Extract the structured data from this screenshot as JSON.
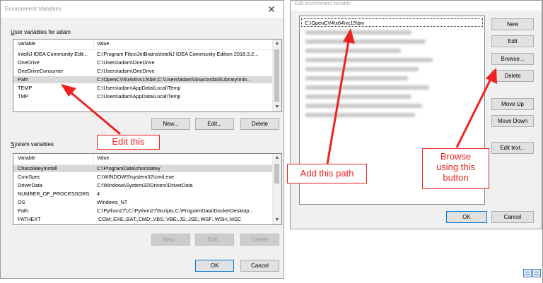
{
  "env_dialog": {
    "title": "Environment Variables",
    "user_section_label_prefix": "U",
    "user_section_label_rest": "ser variables for adam",
    "system_section_label_prefix": "S",
    "system_section_label_rest": "ystem variables",
    "col_variable": "Variable",
    "col_value": "Value",
    "user_vars": [
      {
        "name": "IntelliJ IDEA Community Edit...",
        "value": "C:\\Program Files\\JetBrains\\IntelliJ IDEA Community Edition 2018.3.2..."
      },
      {
        "name": "OneDrive",
        "value": "C:\\Users\\adam\\OneDrive"
      },
      {
        "name": "OneDriveConsumer",
        "value": "C:\\Users\\adam\\OneDrive"
      },
      {
        "name": "Path",
        "value": "C:\\OpenCV4\\x64\\vc15\\bin;C:\\Users\\adam\\Anaconda3\\Library\\min..."
      },
      {
        "name": "TEMP",
        "value": "C:\\Users\\adam\\AppData\\Local\\Temp"
      },
      {
        "name": "TMP",
        "value": "C:\\Users\\adam\\AppData\\Local\\Temp"
      }
    ],
    "system_vars": [
      {
        "name": "ChocolateyInstall",
        "value": "C:\\ProgramData\\chocolatey"
      },
      {
        "name": "ComSpec",
        "value": "C:\\WINDOWS\\system32\\cmd.exe"
      },
      {
        "name": "DriverData",
        "value": "C:\\Windows\\System32\\Drivers\\DriverData"
      },
      {
        "name": "NUMBER_OF_PROCESSORS",
        "value": "4"
      },
      {
        "name": "OS",
        "value": "Windows_NT"
      },
      {
        "name": "Path",
        "value": "C:\\Python27\\;C:\\Python27\\Scripts;C:\\ProgramData\\DockerDesktop..."
      },
      {
        "name": "PATHEXT",
        "value": ".COM;.EXE;.BAT;.CMD;.VBS;.VBE;.JS;.JSE;.WSF;.WSH;.MSC"
      }
    ],
    "user_buttons": {
      "new": "New...",
      "edit": "Edit...",
      "delete": "Delete"
    },
    "system_buttons": {
      "new": "New...",
      "edit": "Edit...",
      "delete": "Delete"
    },
    "ok": "OK",
    "cancel": "Cancel"
  },
  "edit_dialog": {
    "title": "Edit environment variable",
    "paths": [
      "C:\\OpenCV4\\x64\\vc15\\bin"
    ],
    "buttons": {
      "new": "New",
      "edit": "Edit",
      "browse": "Browse...",
      "delete": "Delete",
      "move_up": "Move Up",
      "move_down": "Move Down",
      "edit_text": "Edit text..."
    },
    "ok": "OK",
    "cancel": "Cancel"
  },
  "annotations": {
    "edit_this": "Edit this",
    "add_this_path": "Add this path",
    "browse_line1": "Browse",
    "browse_line2": "using this",
    "browse_line3": "button",
    "color": "#ee2222"
  }
}
